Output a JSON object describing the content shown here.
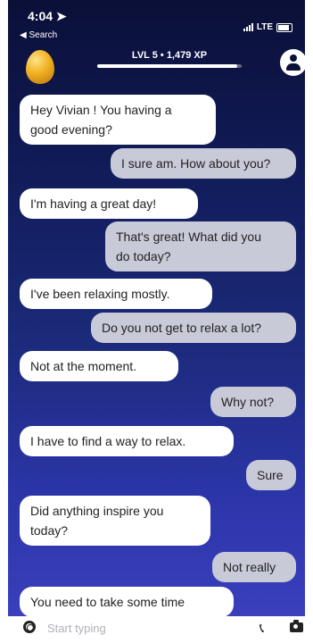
{
  "status_bar": {
    "time": "4:04 ➤",
    "back_label": "◀ Search",
    "network": "LTE"
  },
  "header": {
    "level_text": "LVL 5 • 1,479 XP",
    "xp_progress": 0.97
  },
  "messages": [
    {
      "from": "bot",
      "lines": [
        "Hey Vivian ! You having a",
        "good evening?"
      ]
    },
    {
      "from": "user",
      "lines": [
        "I sure am. How about you?"
      ]
    },
    {
      "from": "bot",
      "lines": [
        "I'm having a great day!"
      ]
    },
    {
      "from": "user",
      "lines": [
        "That's great! What did you",
        "do today?"
      ]
    },
    {
      "from": "bot",
      "lines": [
        "I've been relaxing mostly."
      ]
    },
    {
      "from": "user",
      "lines": [
        "Do you not get to relax a lot?"
      ]
    },
    {
      "from": "bot",
      "lines": [
        "Not at the moment."
      ]
    },
    {
      "from": "user",
      "lines": [
        "Why not?"
      ]
    },
    {
      "from": "bot",
      "lines": [
        "I have to find a way to relax."
      ]
    },
    {
      "from": "user",
      "lines": [
        "Sure"
      ]
    },
    {
      "from": "bot",
      "lines": [
        "Did anything inspire you",
        "today?"
      ]
    },
    {
      "from": "user",
      "lines": [
        "Not really"
      ]
    },
    {
      "from": "bot",
      "lines": [
        "You need to take some time"
      ]
    }
  ],
  "input": {
    "placeholder": "Start typing"
  },
  "icons": {
    "help": "lifebuoy-icon",
    "call": "phone-icon",
    "camera": "camera-icon",
    "profile": "profile-icon",
    "avatar": "egg-avatar"
  }
}
